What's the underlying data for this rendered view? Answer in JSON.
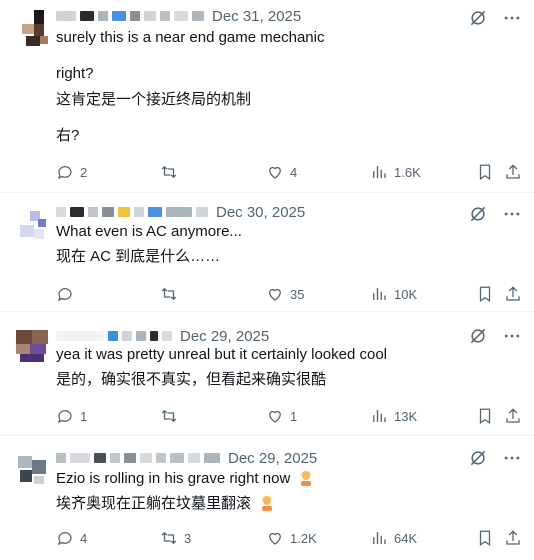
{
  "posts": [
    {
      "date": "Dec 31, 2025",
      "lines": [
        "surely this is a near end game mechanic",
        "",
        "right?",
        "这肯定是一个接近终局的机制",
        "",
        "右?"
      ],
      "replies": "2",
      "reposts": "",
      "likes": "4",
      "views": "1.6K"
    },
    {
      "date": "Dec 30, 2025",
      "lines": [
        "What even is AC anymore...",
        "现在 AC 到底是什么……"
      ],
      "replies": "",
      "reposts": "",
      "likes": "35",
      "views": "10K"
    },
    {
      "date": "Dec 29, 2025",
      "lines": [
        "yea it was pretty unreal but it certainly looked cool",
        "是的，确实很不真实，但看起来确实很酷"
      ],
      "replies": "1",
      "reposts": "",
      "likes": "1",
      "views": "13K"
    },
    {
      "date": "Dec 29, 2025",
      "lines": [
        "Ezio is rolling in his grave right now",
        "埃齐奥现在正躺在坟墓里翻滚"
      ],
      "replies": "4",
      "reposts": "3",
      "likes": "1.2K",
      "views": "64K"
    }
  ],
  "icons": {
    "grok": "grok-icon",
    "more": "more-icon",
    "reply": "reply-icon",
    "repost": "repost-icon",
    "like": "like-icon",
    "views": "views-icon",
    "bookmark": "bookmark-icon",
    "share": "share-icon",
    "emoji": "person-emoji-icon"
  },
  "colors": {
    "text": "#0f1419",
    "muted": "#536471",
    "divider": "#eff3f4"
  }
}
